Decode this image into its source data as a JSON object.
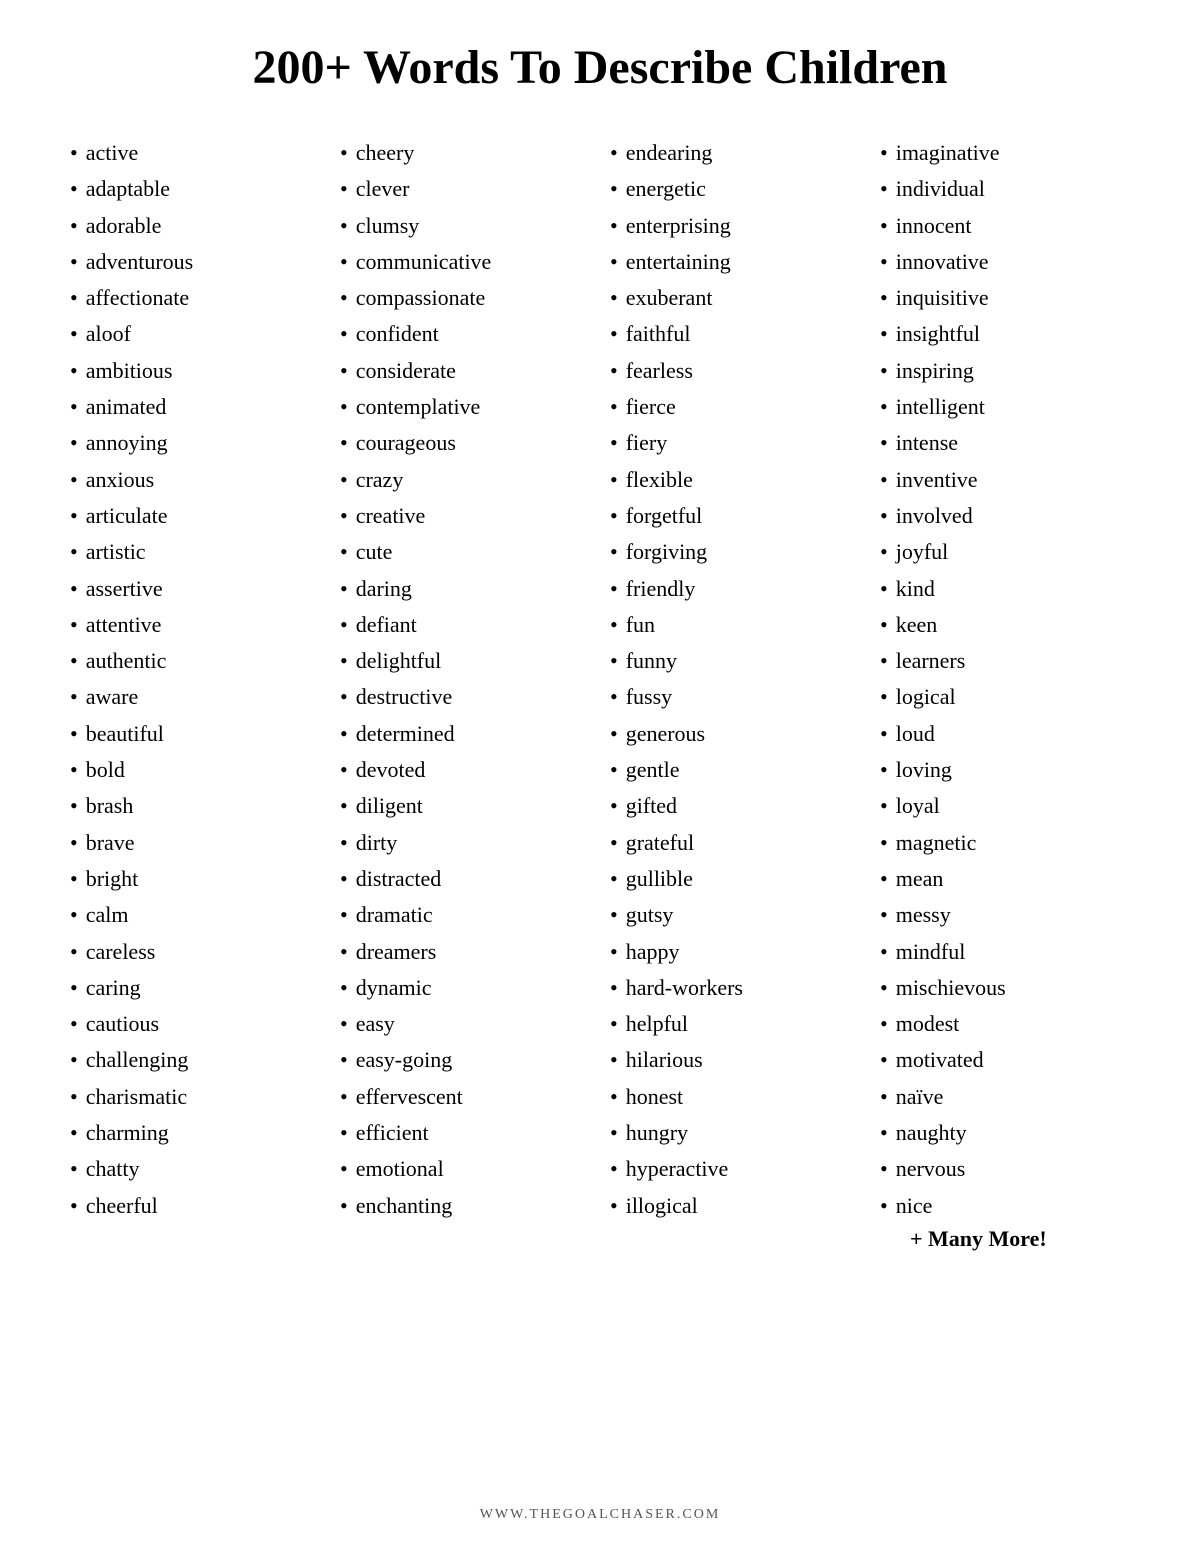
{
  "title": "200+ Words To Describe Children",
  "columns": [
    {
      "id": "col1",
      "items": [
        "active",
        "adaptable",
        "adorable",
        "adventurous",
        "affectionate",
        "aloof",
        "ambitious",
        "animated",
        "annoying",
        "anxious",
        "articulate",
        "artistic",
        "assertive",
        "attentive",
        "authentic",
        "aware",
        "beautiful",
        "bold",
        "brash",
        "brave",
        "bright",
        "calm",
        "careless",
        "caring",
        "cautious",
        "challenging",
        "charismatic",
        "charming",
        "chatty",
        "cheerful"
      ]
    },
    {
      "id": "col2",
      "items": [
        "cheery",
        "clever",
        "clumsy",
        "communicative",
        "compassionate",
        "confident",
        "considerate",
        "contemplative",
        "courageous",
        "crazy",
        "creative",
        "cute",
        "daring",
        "defiant",
        "delightful",
        "destructive",
        "determined",
        "devoted",
        "diligent",
        "dirty",
        "distracted",
        "dramatic",
        "dreamers",
        "dynamic",
        "easy",
        "easy-going",
        "effervescent",
        "efficient",
        "emotional",
        "enchanting"
      ]
    },
    {
      "id": "col3",
      "items": [
        "endearing",
        "energetic",
        "enterprising",
        "entertaining",
        "exuberant",
        "faithful",
        "fearless",
        "fierce",
        "fiery",
        "flexible",
        "forgetful",
        "forgiving",
        "friendly",
        "fun",
        "funny",
        "fussy",
        "generous",
        "gentle",
        "gifted",
        "grateful",
        "gullible",
        "gutsy",
        "happy",
        "hard-workers",
        "helpful",
        "hilarious",
        "honest",
        "hungry",
        "hyperactive",
        "illogical"
      ]
    },
    {
      "id": "col4",
      "items": [
        "imaginative",
        "individual",
        "innocent",
        "innovative",
        "inquisitive",
        "insightful",
        "inspiring",
        "intelligent",
        "intense",
        "inventive",
        "involved",
        "joyful",
        "kind",
        "keen",
        "learners",
        "logical",
        "loud",
        "loving",
        "loyal",
        "magnetic",
        "mean",
        "messy",
        "mindful",
        "mischievous",
        "modest",
        "motivated",
        "naïve",
        "naughty",
        "nervous",
        "nice"
      ],
      "extra": "+ Many More!"
    }
  ],
  "footer": "WWW.THEGOALCHASER.COM"
}
